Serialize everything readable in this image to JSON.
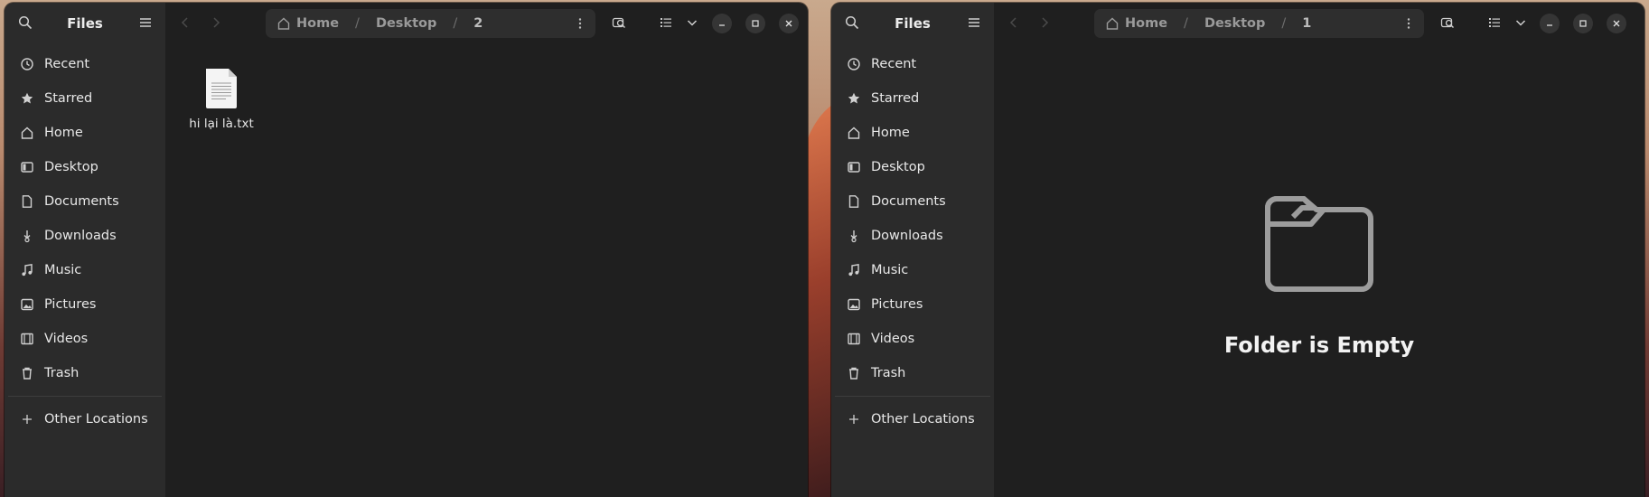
{
  "windows": [
    {
      "sidebar": {
        "title": "Files",
        "items": [
          {
            "label": "Recent",
            "icon": "clock-icon"
          },
          {
            "label": "Starred",
            "icon": "star-icon"
          },
          {
            "label": "Home",
            "icon": "home-icon"
          },
          {
            "label": "Desktop",
            "icon": "desktop-icon"
          },
          {
            "label": "Documents",
            "icon": "documents-icon"
          },
          {
            "label": "Downloads",
            "icon": "download-icon"
          },
          {
            "label": "Music",
            "icon": "music-icon"
          },
          {
            "label": "Pictures",
            "icon": "pictures-icon"
          },
          {
            "label": "Videos",
            "icon": "videos-icon"
          },
          {
            "label": "Trash",
            "icon": "trash-icon"
          }
        ],
        "other_locations": "Other Locations"
      },
      "pathbar": {
        "home": "Home",
        "desktop": "Desktop",
        "current": "2"
      },
      "files": [
        {
          "name": "hi lại là.txt",
          "icon": "text-file-icon"
        }
      ]
    },
    {
      "sidebar": {
        "title": "Files",
        "items": [
          {
            "label": "Recent",
            "icon": "clock-icon"
          },
          {
            "label": "Starred",
            "icon": "star-icon"
          },
          {
            "label": "Home",
            "icon": "home-icon"
          },
          {
            "label": "Desktop",
            "icon": "desktop-icon"
          },
          {
            "label": "Documents",
            "icon": "documents-icon"
          },
          {
            "label": "Downloads",
            "icon": "download-icon"
          },
          {
            "label": "Music",
            "icon": "music-icon"
          },
          {
            "label": "Pictures",
            "icon": "pictures-icon"
          },
          {
            "label": "Videos",
            "icon": "videos-icon"
          },
          {
            "label": "Trash",
            "icon": "trash-icon"
          }
        ],
        "other_locations": "Other Locations"
      },
      "pathbar": {
        "home": "Home",
        "desktop": "Desktop",
        "current": "1"
      },
      "empty_message": "Folder is Empty"
    }
  ]
}
